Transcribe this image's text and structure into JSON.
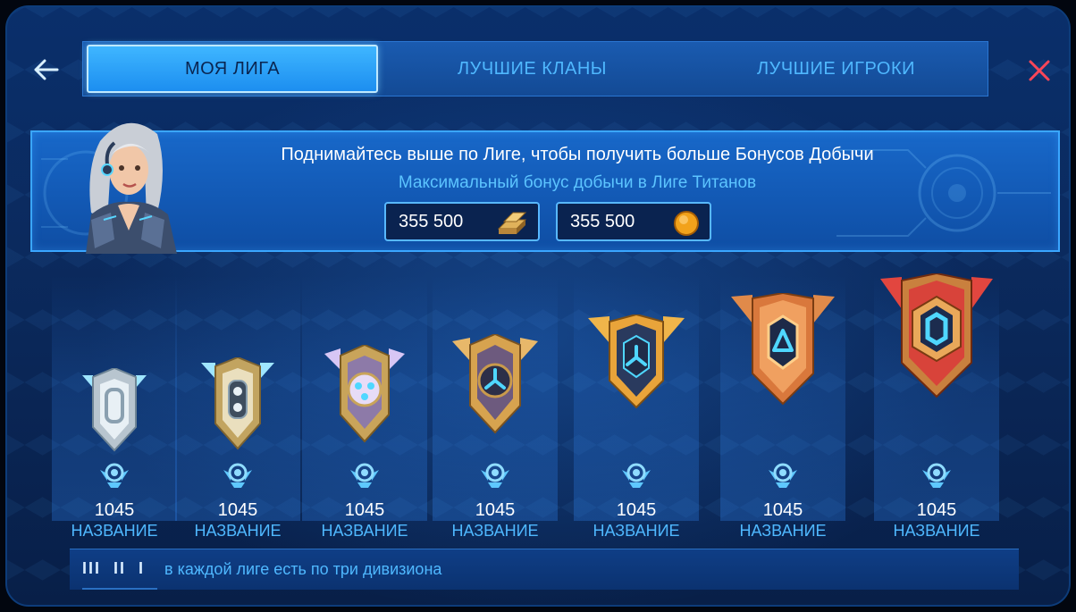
{
  "tabs": [
    {
      "label": "МОЯ ЛИГА",
      "active": true
    },
    {
      "label": "ЛУЧШИЕ КЛАНЫ",
      "active": false
    },
    {
      "label": "ЛУЧШИЕ ИГРОКИ",
      "active": false
    }
  ],
  "icons": {
    "back": "arrow-left-icon",
    "close": "close-icon",
    "resource1": "gold-bars-icon",
    "resource2": "coin-icon",
    "rank": "rank-emblem-icon"
  },
  "banner": {
    "title": "Поднимайтесь выше по Лиге, чтобы получить больше Бонусов Добычи",
    "subtitle": "Максимальный бонус добычи в Лиге Титанов",
    "rewards": [
      {
        "amount": "355 500",
        "icon": "gold-bars-icon"
      },
      {
        "amount": "355 500",
        "icon": "coin-icon"
      }
    ]
  },
  "leagues": [
    {
      "score": "1045",
      "name": "НАЗВАНИЕ",
      "tier": "silver"
    },
    {
      "score": "1045",
      "name": "НАЗВАНИЕ",
      "tier": "silver-gold"
    },
    {
      "score": "1045",
      "name": "НАЗВАНИЕ",
      "tier": "gold-purple"
    },
    {
      "score": "1045",
      "name": "НАЗВАНИЕ",
      "tier": "gold-dark"
    },
    {
      "score": "1045",
      "name": "НАЗВАНИЕ",
      "tier": "gold"
    },
    {
      "score": "1045",
      "name": "НАЗВАНИЕ",
      "tier": "bronze"
    },
    {
      "score": "1045",
      "name": "НАЗВАНИЕ",
      "tier": "titan"
    }
  ],
  "footer": {
    "divisions": [
      "III",
      "II",
      "I"
    ],
    "text": "в каждой лиге есть по три дивизиона"
  },
  "colors": {
    "accent": "#4fb8ff",
    "active_tab": "#2ea4fb",
    "close": "#ff3b4a"
  }
}
